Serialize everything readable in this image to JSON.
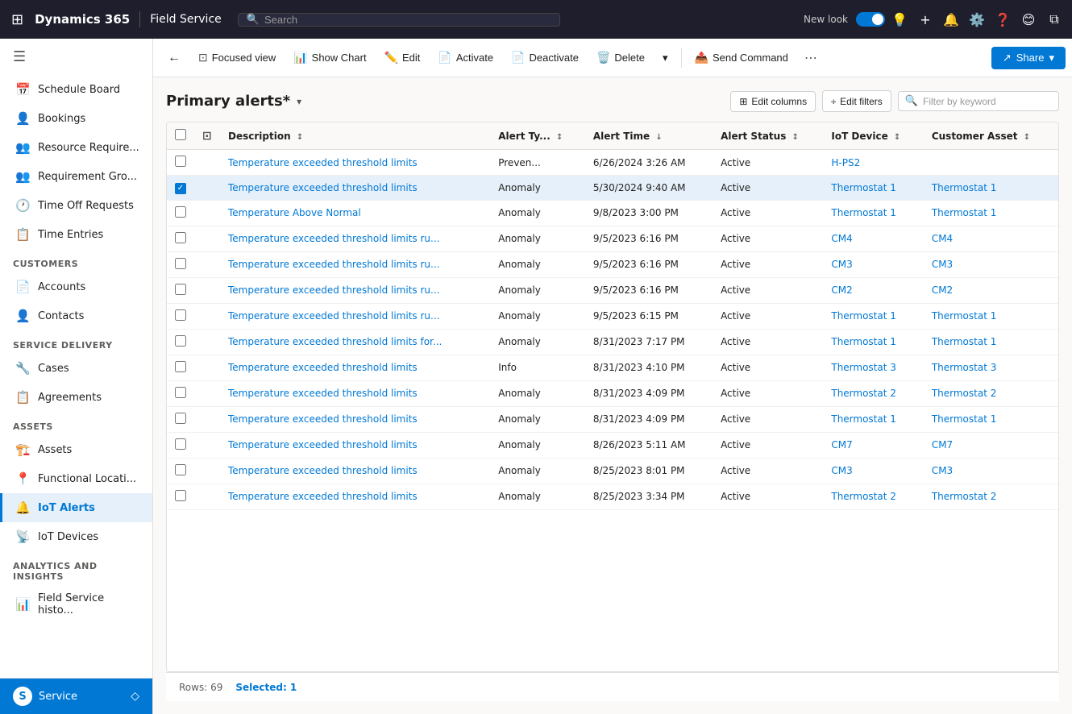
{
  "app": {
    "title": "Dynamics 365",
    "module": "Field Service",
    "search_placeholder": "Search"
  },
  "topnav": {
    "new_look_label": "New look",
    "share_label": "Share"
  },
  "toolbar": {
    "back_label": "←",
    "focused_view_label": "Focused view",
    "show_chart_label": "Show Chart",
    "edit_label": "Edit",
    "activate_label": "Activate",
    "deactivate_label": "Deactivate",
    "delete_label": "Delete",
    "send_command_label": "Send Command",
    "more_label": "···",
    "share_label": "Share"
  },
  "grid": {
    "title": "Primary alerts",
    "title_suffix": "*",
    "filter_placeholder": "Filter by keyword",
    "edit_columns_label": "Edit columns",
    "edit_filters_label": "Edit filters",
    "footer_rows": "Rows: 69",
    "footer_selected": "Selected: 1",
    "columns": [
      {
        "id": "description",
        "label": "Description",
        "sortable": true,
        "sort": "desc"
      },
      {
        "id": "alert_type",
        "label": "Alert Ty...",
        "sortable": true
      },
      {
        "id": "alert_time",
        "label": "Alert Time",
        "sortable": true,
        "sort": "desc"
      },
      {
        "id": "alert_status",
        "label": "Alert Status",
        "sortable": true
      },
      {
        "id": "iot_device",
        "label": "IoT Device",
        "sortable": true
      },
      {
        "id": "customer_asset",
        "label": "Customer Asset",
        "sortable": true
      }
    ],
    "rows": [
      {
        "id": 1,
        "description": "Temperature exceeded threshold limits",
        "alert_type": "Preven...",
        "alert_time": "6/26/2024 3:26 AM",
        "alert_status": "Active",
        "iot_device": "H-PS2",
        "customer_asset": "",
        "selected": false,
        "device_link": true,
        "asset_link": false
      },
      {
        "id": 2,
        "description": "Temperature exceeded threshold limits",
        "alert_type": "Anomaly",
        "alert_time": "5/30/2024 9:40 AM",
        "alert_status": "Active",
        "iot_device": "Thermostat 1",
        "customer_asset": "Thermostat 1",
        "selected": true,
        "device_link": true,
        "asset_link": true
      },
      {
        "id": 3,
        "description": "Temperature Above Normal",
        "alert_type": "Anomaly",
        "alert_time": "9/8/2023 3:00 PM",
        "alert_status": "Active",
        "iot_device": "Thermostat 1",
        "customer_asset": "Thermostat 1",
        "selected": false,
        "device_link": true,
        "asset_link": true
      },
      {
        "id": 4,
        "description": "Temperature exceeded threshold limits ru...",
        "alert_type": "Anomaly",
        "alert_time": "9/5/2023 6:16 PM",
        "alert_status": "Active",
        "iot_device": "CM4",
        "customer_asset": "CM4",
        "selected": false,
        "device_link": true,
        "asset_link": true
      },
      {
        "id": 5,
        "description": "Temperature exceeded threshold limits ru...",
        "alert_type": "Anomaly",
        "alert_time": "9/5/2023 6:16 PM",
        "alert_status": "Active",
        "iot_device": "CM3",
        "customer_asset": "CM3",
        "selected": false,
        "device_link": true,
        "asset_link": true
      },
      {
        "id": 6,
        "description": "Temperature exceeded threshold limits ru...",
        "alert_type": "Anomaly",
        "alert_time": "9/5/2023 6:16 PM",
        "alert_status": "Active",
        "iot_device": "CM2",
        "customer_asset": "CM2",
        "selected": false,
        "device_link": true,
        "asset_link": true
      },
      {
        "id": 7,
        "description": "Temperature exceeded threshold limits ru...",
        "alert_type": "Anomaly",
        "alert_time": "9/5/2023 6:15 PM",
        "alert_status": "Active",
        "iot_device": "Thermostat 1",
        "customer_asset": "Thermostat 1",
        "selected": false,
        "device_link": true,
        "asset_link": true
      },
      {
        "id": 8,
        "description": "Temperature exceeded threshold limits for...",
        "alert_type": "Anomaly",
        "alert_time": "8/31/2023 7:17 PM",
        "alert_status": "Active",
        "iot_device": "Thermostat 1",
        "customer_asset": "Thermostat 1",
        "selected": false,
        "device_link": true,
        "asset_link": true
      },
      {
        "id": 9,
        "description": "Temperature exceeded threshold limits",
        "alert_type": "Info",
        "alert_time": "8/31/2023 4:10 PM",
        "alert_status": "Active",
        "iot_device": "Thermostat 3",
        "customer_asset": "Thermostat 3",
        "selected": false,
        "device_link": true,
        "asset_link": true
      },
      {
        "id": 10,
        "description": "Temperature exceeded threshold limits",
        "alert_type": "Anomaly",
        "alert_time": "8/31/2023 4:09 PM",
        "alert_status": "Active",
        "iot_device": "Thermostat 2",
        "customer_asset": "Thermostat 2",
        "selected": false,
        "device_link": true,
        "asset_link": true
      },
      {
        "id": 11,
        "description": "Temperature exceeded threshold limits",
        "alert_type": "Anomaly",
        "alert_time": "8/31/2023 4:09 PM",
        "alert_status": "Active",
        "iot_device": "Thermostat 1",
        "customer_asset": "Thermostat 1",
        "selected": false,
        "device_link": true,
        "asset_link": true
      },
      {
        "id": 12,
        "description": "Temperature exceeded threshold limits",
        "alert_type": "Anomaly",
        "alert_time": "8/26/2023 5:11 AM",
        "alert_status": "Active",
        "iot_device": "CM7",
        "customer_asset": "CM7",
        "selected": false,
        "device_link": true,
        "asset_link": true
      },
      {
        "id": 13,
        "description": "Temperature exceeded threshold limits",
        "alert_type": "Anomaly",
        "alert_time": "8/25/2023 8:01 PM",
        "alert_status": "Active",
        "iot_device": "CM3",
        "customer_asset": "CM3",
        "selected": false,
        "device_link": true,
        "asset_link": true
      },
      {
        "id": 14,
        "description": "Temperature exceeded threshold limits",
        "alert_type": "Anomaly",
        "alert_time": "8/25/2023 3:34 PM",
        "alert_status": "Active",
        "iot_device": "Thermostat 2",
        "customer_asset": "Thermostat 2",
        "selected": false,
        "device_link": true,
        "asset_link": true
      }
    ]
  },
  "sidebar": {
    "sections": [
      {
        "label": "",
        "items": [
          {
            "id": "schedule-board",
            "label": "Schedule Board",
            "icon": "📅"
          },
          {
            "id": "bookings",
            "label": "Bookings",
            "icon": "👤"
          },
          {
            "id": "resource-require",
            "label": "Resource Require...",
            "icon": "👥"
          },
          {
            "id": "requirement-group",
            "label": "Requirement Gro...",
            "icon": "👥"
          },
          {
            "id": "time-off-requests",
            "label": "Time Off Requests",
            "icon": "🕐"
          },
          {
            "id": "time-entries",
            "label": "Time Entries",
            "icon": "📋"
          }
        ]
      },
      {
        "label": "Customers",
        "items": [
          {
            "id": "accounts",
            "label": "Accounts",
            "icon": "📄"
          },
          {
            "id": "contacts",
            "label": "Contacts",
            "icon": "👤"
          }
        ]
      },
      {
        "label": "Service Delivery",
        "items": [
          {
            "id": "cases",
            "label": "Cases",
            "icon": "🔧"
          },
          {
            "id": "agreements",
            "label": "Agreements",
            "icon": "📋"
          }
        ]
      },
      {
        "label": "Assets",
        "items": [
          {
            "id": "assets",
            "label": "Assets",
            "icon": "🏗️"
          },
          {
            "id": "functional-locati",
            "label": "Functional Locati...",
            "icon": "📍"
          },
          {
            "id": "iot-alerts",
            "label": "IoT Alerts",
            "icon": "🔔",
            "active": true
          },
          {
            "id": "iot-devices",
            "label": "IoT Devices",
            "icon": "📡"
          }
        ]
      },
      {
        "label": "Analytics and Insights",
        "items": [
          {
            "id": "field-service-histo",
            "label": "Field Service histo...",
            "icon": "📊"
          }
        ]
      }
    ],
    "footer_label": "Service"
  }
}
